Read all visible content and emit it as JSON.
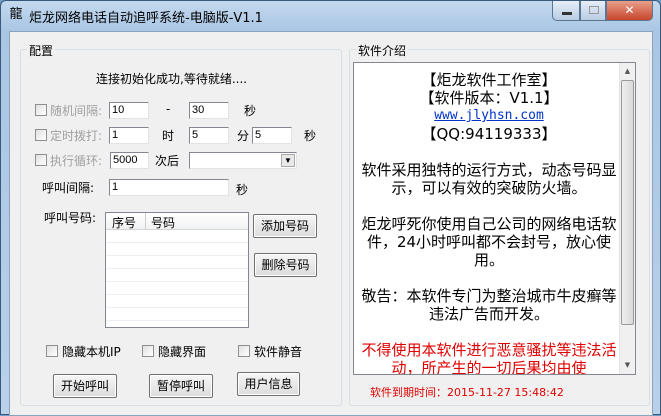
{
  "window": {
    "title": "炬龙网络电话自动追呼系统-电脑版-V1.1"
  },
  "config": {
    "group_label": "配置",
    "status": "连接初始化成功,等待就绪....",
    "random_interval": {
      "label": "随机间隔:",
      "min": "10",
      "dash": "-",
      "max": "30",
      "unit": "秒"
    },
    "timed_dial": {
      "label": "定时拨打:",
      "hour": "1",
      "hour_unit": "时",
      "minute": "5",
      "minute_unit": "分",
      "second": "5",
      "second_unit": "秒"
    },
    "loop": {
      "label": "执行循环:",
      "count": "5000",
      "after": "次后",
      "select_value": ""
    },
    "call_interval": {
      "label": "呼叫间隔:",
      "value": "1",
      "unit": "秒"
    },
    "numbers": {
      "label": "呼叫号码:",
      "columns": [
        "序号",
        "号码"
      ],
      "rows": []
    },
    "add_button": "添加号码",
    "delete_button": "删除号码",
    "hide_ip": "隐藏本机IP",
    "hide_ui": "隐藏界面",
    "mute": "软件静音",
    "start_button": "开始呼叫",
    "pause_button": "暂停呼叫",
    "user_button": "用户信息"
  },
  "intro": {
    "group_label": "软件介绍",
    "studio": "【炬龙软件工作室】",
    "version": "【软件版本：V1.1】",
    "website": "www.jlyhsn.com",
    "qq": "【QQ:94119333】",
    "p1": "软件采用独特的运行方式，动态号码显示，可以有效的突破防火墙。",
    "p2": "炬龙呼死你使用自己公司的网络电话软件，24小时呼叫都不会封号，放心使用。",
    "p3": "敬告：本软件专门为整治城市牛皮癣等违法广告而开发。",
    "p4": "不得使用本软件进行恶意骚扰等违法活动，所产生的一切后果均由使",
    "expiry": "软件到期时间：2015-11-27 15:48:42"
  },
  "colors": {
    "warning": "#e00000",
    "link": "#0033cc"
  }
}
